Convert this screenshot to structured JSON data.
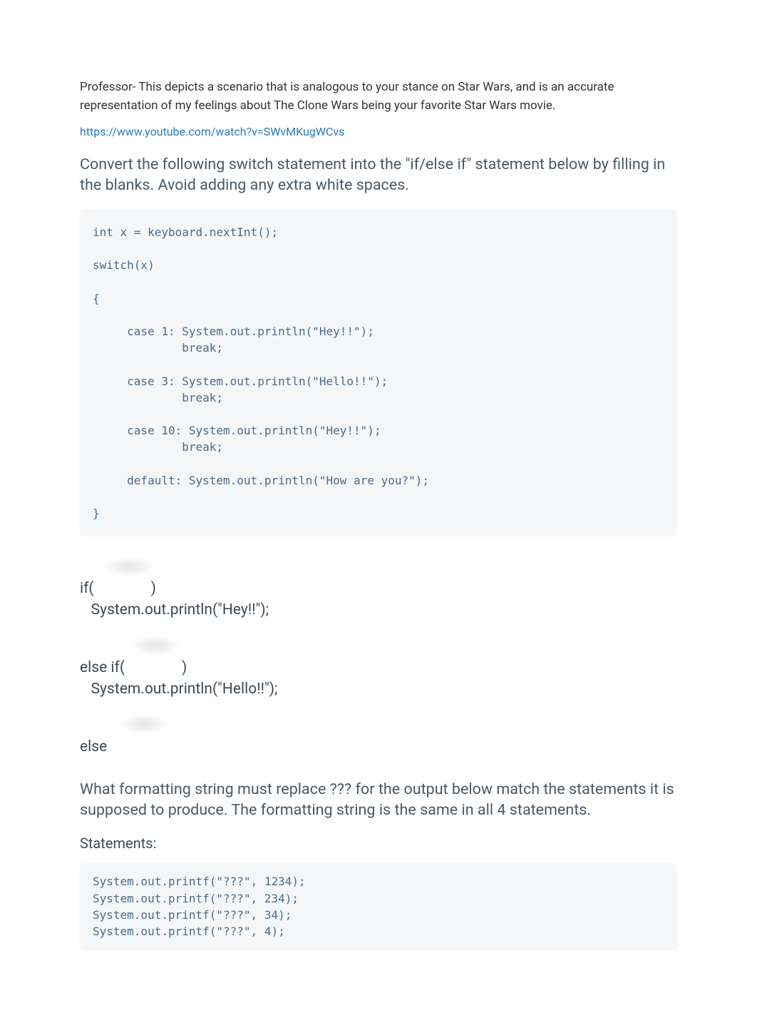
{
  "intro": "Professor- This depicts a scenario that is analogous to your stance on Star Wars, and is an accurate representation of my feelings about The Clone Wars being your favorite Star Wars movie.",
  "link_text": "https://www.youtube.com/watch?v=SWvMKugWCvs",
  "q1_prompt": "Convert the following switch statement into the \"if/else if\" statement below by filling in the blanks. Avoid adding any extra white spaces.",
  "code1": "int x = keyboard.nextInt();\n\nswitch(x)\n\n{\n\n     case 1: System.out.println(\"Hey!!\");\n             break;\n\n     case 3: System.out.println(\"Hello!!\");\n             break;\n\n     case 10: System.out.println(\"Hey!!\");\n             break;\n\n     default: System.out.println(\"How are you?\");\n\n}",
  "ans": {
    "if_open": "if(",
    "paren_close": ")",
    "print_hey": "   System.out.println(\"Hey!!\");",
    "elseif_open": "else if(",
    "print_hello": "   System.out.println(\"Hello!!\");",
    "else_kw": "else"
  },
  "q2_prompt": "What formatting string must replace ??? for the output below match the statements it is supposed to produce. The formatting string is the same in all 4 statements.",
  "statements_label": "Statements:",
  "code2": "System.out.printf(\"???\", 1234);\nSystem.out.printf(\"???\", 234);\nSystem.out.printf(\"???\", 34);\nSystem.out.printf(\"???\", 4);"
}
